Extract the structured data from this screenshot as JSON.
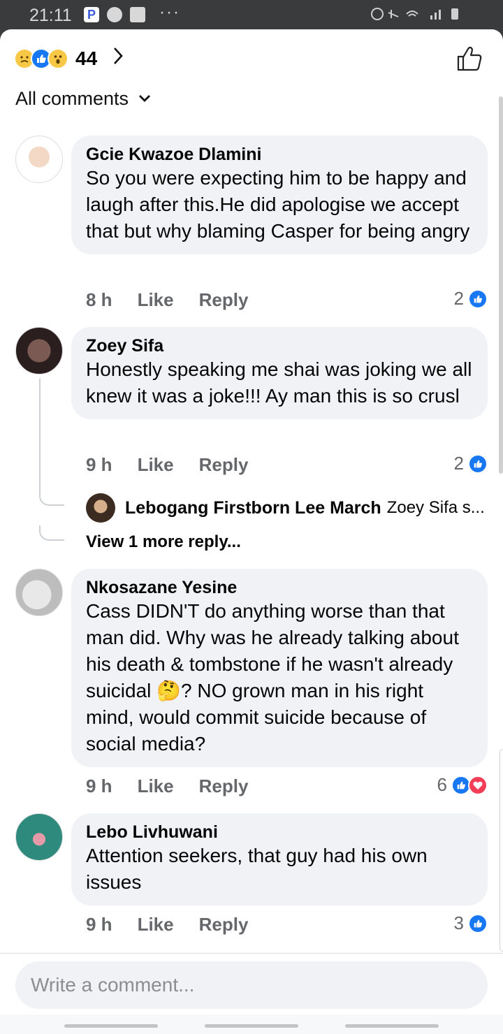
{
  "status_bar": {
    "time": "21:11",
    "left_icons": [
      "p-app-icon",
      "music-icon",
      "image-icon"
    ],
    "more": "···",
    "right_icons": [
      "alarm-icon",
      "mute-icon",
      "wifi-icon",
      "signal-icon",
      "battery-icon"
    ]
  },
  "header": {
    "reactions": [
      "sad-reaction-icon",
      "like-reaction-icon",
      "wow-reaction-icon"
    ],
    "reaction_count": "44",
    "like_button": "thumbs-up-outline-icon",
    "filter_label": "All comments"
  },
  "comments": [
    {
      "author": "Gcie Kwazoe Dlamini",
      "text": "So you were expecting him to be happy and laugh after this.He did apologise we accept that but why blaming Casper for being angry",
      "time": "8 h",
      "like_label": "Like",
      "reply_label": "Reply",
      "reaction_count": "2"
    },
    {
      "author": "Zoey Sifa",
      "text": "Honestly speaking me shai was joking we all knew it was a joke!!! Ay man this is so crusl",
      "time": "9 h",
      "like_label": "Like",
      "reply_label": "Reply",
      "reaction_count": "2",
      "reply_preview": {
        "author": "Lebogang Firstborn Lee March",
        "snippet": "Zoey Sifa s..."
      },
      "view_more": "View 1 more reply..."
    },
    {
      "author": "Nkosazane Yesine",
      "text": "Cass DIDN'T do anything worse than that man did. Why was he already talking about his death & tombstone if he wasn't already suicidal 🤔? NO grown man in his right mind, would commit suicide because of social media?",
      "time": "9 h",
      "like_label": "Like",
      "reply_label": "Reply",
      "reaction_count": "6"
    },
    {
      "author": "Lebo Livhuwani",
      "text": "Attention seekers, that guy had his own issues",
      "time": "9 h",
      "like_label": "Like",
      "reply_label": "Reply",
      "reaction_count": "3"
    }
  ],
  "composer": {
    "placeholder": "Write a comment..."
  },
  "colors": {
    "accent": "#1877f2",
    "bubble": "#f0f2f5",
    "meta_text": "#65676b",
    "heart": "#f33e58"
  }
}
